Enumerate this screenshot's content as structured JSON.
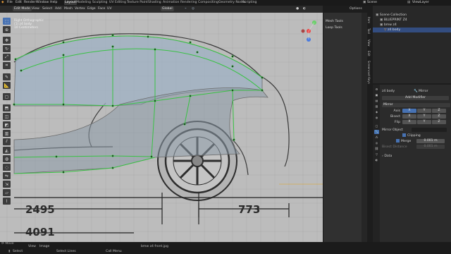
{
  "topbar": {
    "menus": [
      "File",
      "Edit",
      "Render",
      "Window",
      "Help"
    ],
    "workspaces": [
      "Layout",
      "Modeling",
      "Sculpting",
      "UV Editing",
      "Texture Paint",
      "Shading",
      "Animation",
      "Rendering",
      "Compositing",
      "Geometry Nodes",
      "Scripting"
    ],
    "active_workspace": "Layout",
    "scene_label": "Scene",
    "viewlayer_label": "ViewLayer"
  },
  "viewport_header": {
    "mode": "Edit Mode",
    "menus": [
      "View",
      "Select",
      "Add",
      "Mesh",
      "Vertex",
      "Edge",
      "Face",
      "UV"
    ],
    "transform_orientation": "Global",
    "options_label": "Options"
  },
  "viewport_overlay": {
    "lines": [
      "Right Orthographic",
      "(1) z4 body",
      "10 Centimeters"
    ]
  },
  "dimensions": {
    "dim1": "2495",
    "dim2": "773",
    "dim3": "4091"
  },
  "npanel": {
    "items": [
      "Mesh Tools",
      "Loop Tools"
    ],
    "tabs": [
      "Item",
      "Tool",
      "View",
      "Edit",
      "Screencast Keys"
    ]
  },
  "outliner": {
    "rows": [
      {
        "label": "Scene Collection"
      },
      {
        "label": "BLUEPRINT Z4"
      },
      {
        "label": "bmw z4"
      },
      {
        "label": "z4 body"
      }
    ]
  },
  "properties": {
    "object_name": "z4 body",
    "modifier_tab": "Mirror",
    "add_modifier": "Add Modifier",
    "modifier_name": "Mirror",
    "axis_label": "Axis",
    "bisect_label": "Bisect",
    "flip_label": "Flip",
    "axis_values": [
      "X",
      "Y",
      "Z"
    ],
    "mirror_object_label": "Mirror Object",
    "clipping_label": "Clipping",
    "merge_label": "Merge",
    "merge_value": "0.001 m",
    "bisect_distance_label": "Bisect Distance",
    "bisect_distance_value": "0.001 m",
    "data_label": "Data"
  },
  "statusbar": {
    "header_bottom": [
      "Move",
      "View",
      "Image"
    ],
    "select_label": "Select",
    "box_label": "Select Lines",
    "menu_label": "Call Menu",
    "image_name": "bmw z4 front.jpg",
    "frame_label": "(1)"
  },
  "colors": {
    "accent_blue": "#4772b3",
    "mesh_green": "#39c244",
    "viewport_bg": "#bcbcbc",
    "orange": "#e6a11a"
  }
}
